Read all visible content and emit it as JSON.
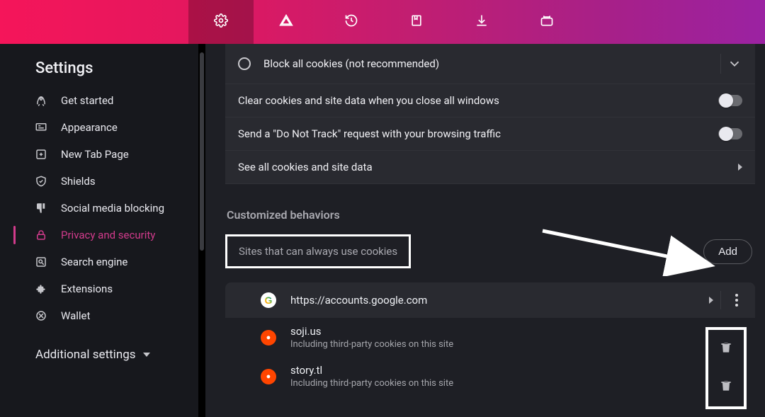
{
  "topbar": {
    "icons": [
      "settings-icon",
      "warning-icon",
      "history-icon",
      "bookmarks-icon",
      "downloads-icon",
      "wallet-icon"
    ]
  },
  "sidebar": {
    "title": "Settings",
    "items": [
      {
        "icon": "rocket-icon",
        "label": "Get started"
      },
      {
        "icon": "appearance-icon",
        "label": "Appearance"
      },
      {
        "icon": "newtab-icon",
        "label": "New Tab Page"
      },
      {
        "icon": "shield-icon",
        "label": "Shields"
      },
      {
        "icon": "thumbsdown-icon",
        "label": "Social media blocking"
      },
      {
        "icon": "lock-icon",
        "label": "Privacy and security"
      },
      {
        "icon": "search-icon",
        "label": "Search engine"
      },
      {
        "icon": "puzzle-icon",
        "label": "Extensions"
      },
      {
        "icon": "walletnav-icon",
        "label": "Wallet"
      }
    ],
    "additional_label": "Additional settings"
  },
  "cookies": {
    "block_all_label": "Block all cookies (not recommended)",
    "clear_on_close_label": "Clear cookies and site data when you close all windows",
    "do_not_track_label": "Send a \"Do Not Track\" request with your browsing traffic",
    "see_all_label": "See all cookies and site data"
  },
  "custom": {
    "section_title": "Customized behaviors",
    "always_title": "Sites that can always use cookies",
    "add_label": "Add",
    "sites": [
      {
        "favicon": "google",
        "name": "https://accounts.google.com",
        "sub": ""
      },
      {
        "favicon": "reddit",
        "name": "soji.us",
        "sub": "Including third-party cookies on this site"
      },
      {
        "favicon": "reddit",
        "name": "story.tl",
        "sub": "Including third-party cookies on this site"
      }
    ]
  }
}
